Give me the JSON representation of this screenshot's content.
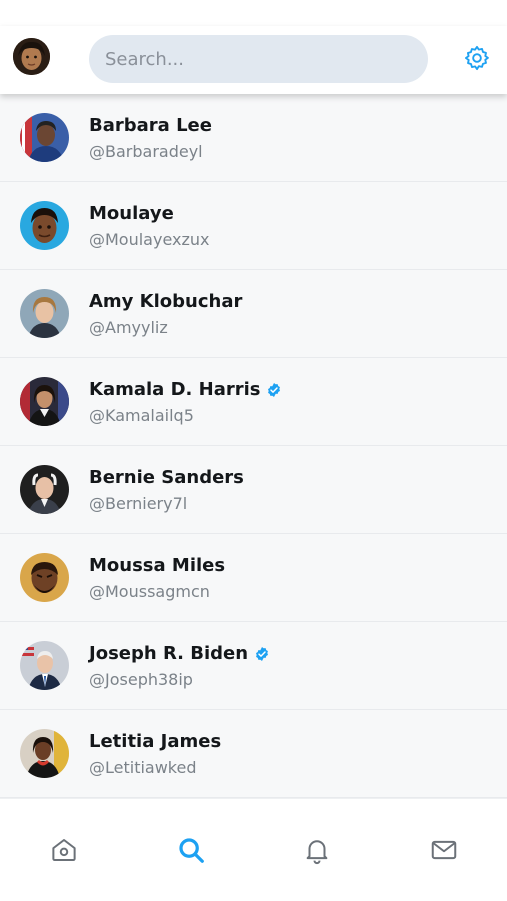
{
  "header": {
    "search_placeholder": "Search...",
    "settings_icon": "gear-icon",
    "accent_color": "#1da1f2"
  },
  "users": [
    {
      "name": "Barbara Lee",
      "handle": "@Barbaradeyl",
      "verified": false
    },
    {
      "name": "Moulaye",
      "handle": "@Moulayexzux",
      "verified": false
    },
    {
      "name": "Amy Klobuchar",
      "handle": "@Amyyliz",
      "verified": false
    },
    {
      "name": "Kamala D. Harris",
      "handle": "@Kamalailq5",
      "verified": true
    },
    {
      "name": "Bernie Sanders",
      "handle": "@Berniery7l",
      "verified": false
    },
    {
      "name": "Moussa Miles",
      "handle": "@Moussagmcn",
      "verified": false
    },
    {
      "name": "Joseph R. Biden",
      "handle": "@Joseph38ip",
      "verified": true
    },
    {
      "name": "Letitia James",
      "handle": "@Letitiawked",
      "verified": false
    }
  ],
  "tabbar": {
    "active": "search",
    "tabs": [
      {
        "id": "home",
        "icon": "home-icon"
      },
      {
        "id": "search",
        "icon": "search-icon"
      },
      {
        "id": "notifications",
        "icon": "bell-icon"
      },
      {
        "id": "messages",
        "icon": "mail-icon"
      }
    ]
  }
}
